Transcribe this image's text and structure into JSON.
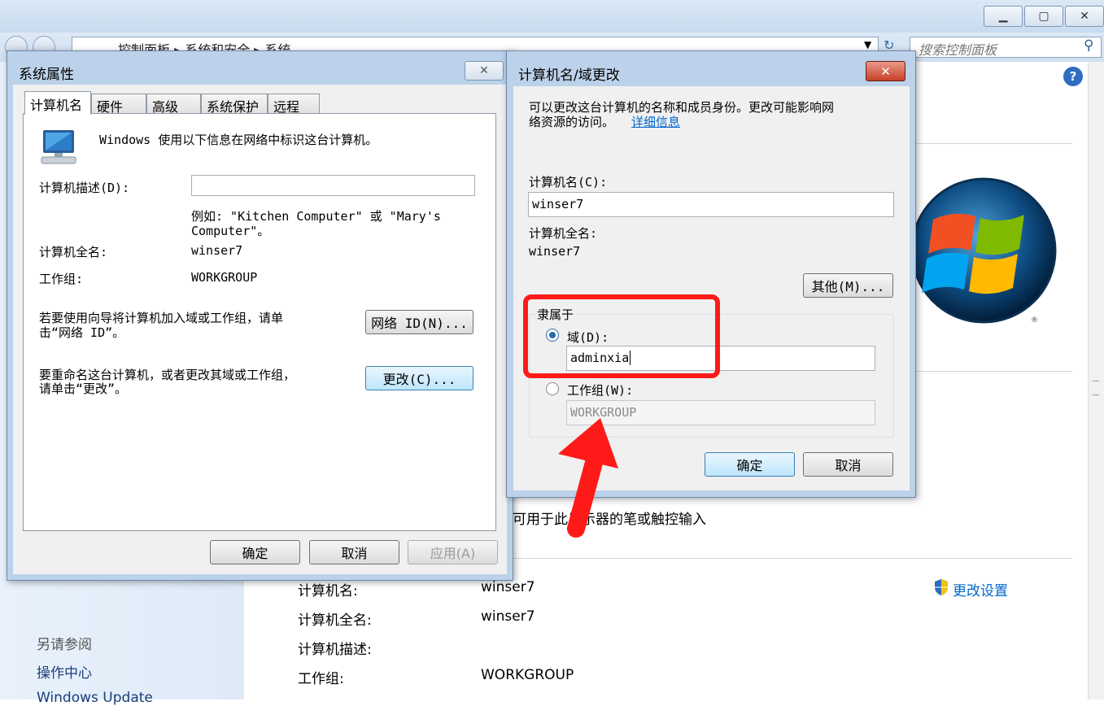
{
  "window": {
    "breadcrumb": "控制面板 ▸ 系统和安全 ▸ 系统",
    "search_placeholder": "搜索控制面板"
  },
  "background": {
    "pen_touch_text": "可用于此显示器的笔或触控输入",
    "see_also_label": "另请参阅",
    "action_center_link": "操作中心",
    "windows_update_link": "Windows Update",
    "change_settings_link": "更改设置",
    "rows": [
      {
        "label": "计算机名:",
        "value": "winser7"
      },
      {
        "label": "计算机全名:",
        "value": "winser7"
      },
      {
        "label": "计算机描述:",
        "value": ""
      },
      {
        "label": "工作组:",
        "value": "WORKGROUP"
      }
    ]
  },
  "sysprops": {
    "title": "系统属性",
    "tabs": [
      "计算机名",
      "硬件",
      "高级",
      "系统保护",
      "远程"
    ],
    "intro": "Windows 使用以下信息在网络中标识这台计算机。",
    "desc_label": "计算机描述(D):",
    "example_line1": "例如: \"Kitchen Computer\" 或 \"Mary's",
    "example_line2": "Computer\"。",
    "fullname_label": "计算机全名:",
    "fullname_value": "winser7",
    "workgroup_label": "工作组:",
    "workgroup_value": "WORKGROUP",
    "wizard_text_line1": "若要使用向导将计算机加入域或工作组，请单",
    "wizard_text_line2": "击“网络 ID”。",
    "network_id_button": "网络 ID(N)...",
    "rename_text_line1": "要重命名这台计算机，或者更改其域或工作组，",
    "rename_text_line2": "请单击“更改”。",
    "change_button": "更改(C)...",
    "ok_button": "确定",
    "cancel_button": "取消",
    "apply_button": "应用(A)"
  },
  "rename": {
    "title": "计算机名/域更改",
    "intro_line1": "可以更改这台计算机的名称和成员身份。更改可能影响网",
    "intro_line2": "络资源的访问。",
    "details_link": "详细信息",
    "name_label": "计算机名(C):",
    "name_value": "winser7",
    "fullname_label": "计算机全名:",
    "fullname_value": "winser7",
    "more_button": "其他(M)...",
    "member_of_label": "隶属于",
    "domain_label": "域(D):",
    "domain_value": "adminxia",
    "workgroup_label": "工作组(W):",
    "workgroup_value": "WORKGROUP",
    "ok_button": "确定",
    "cancel_button": "取消"
  },
  "colors": {
    "annotation_red": "#ff1a1a",
    "link_blue": "#0066cc"
  }
}
